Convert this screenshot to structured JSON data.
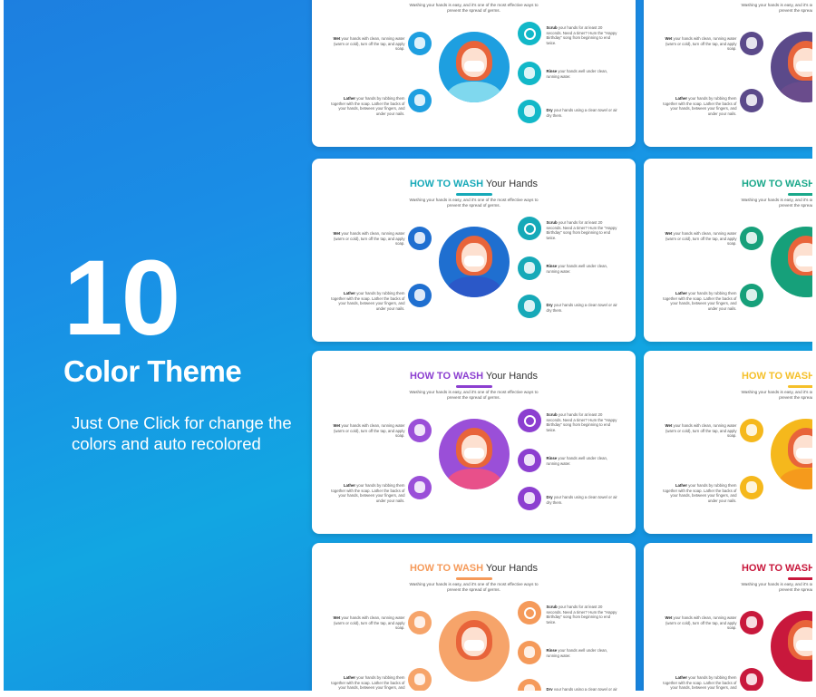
{
  "hero": {
    "number": "10",
    "title": "Color Theme",
    "description": "Just One Click for change the colors and auto recolored"
  },
  "slide": {
    "title_accent": "HOW TO WASH",
    "title_rest": " Your Hands",
    "description": "Washing your hands is easy, and it's one of the most effective ways to prevent the spread of germs.",
    "wet_bold": "Wet",
    "wet_text": " your hands with clean, running water (warm or cold), turn off the tap, and apply soap.",
    "lather_bold": "Lather",
    "lather_text": " your hands by rubbing them together with the soap. Lather the backs of your hands, between your fingers, and under your nails.",
    "scrub_bold": "Scrub",
    "scrub_text": " your hands for at least 20 seconds. Need a timer? Hum the \"Happy Birthday\" song from beginning to end twice.",
    "rinse_bold": "Rinse",
    "rinse_text": " your hands well under clean, running water.",
    "dry_bold": "Dry",
    "dry_text": " your hands using a clean towel or air dry them."
  },
  "themes": {
    "teal_blue": {
      "accent": "#12b8c8",
      "circle": "#1e9fe0",
      "body": "#7fd8ee"
    },
    "purple_dark": {
      "accent": "#6a4c8c",
      "circle": "#5b4a8a",
      "body": "#6a4c8c"
    },
    "teal_green": {
      "accent": "#16a9b8",
      "circle": "#1f6fd0",
      "body": "#2b58c8"
    },
    "green": {
      "accent": "#1aa88a",
      "circle": "#16a07a",
      "body": "#16a07a"
    },
    "purple": {
      "accent": "#8c3fd0",
      "circle": "#9a4fd8",
      "body": "#e8508a"
    },
    "yellow": {
      "accent": "#f5c02a",
      "circle": "#f5b81c",
      "body": "#f59a1c"
    },
    "orange": {
      "accent": "#f59a5a",
      "circle": "#f6a46a",
      "body": "#f6a46a"
    },
    "red": {
      "accent": "#c8183c",
      "circle": "#c8183c",
      "body": "#c8183c"
    }
  }
}
